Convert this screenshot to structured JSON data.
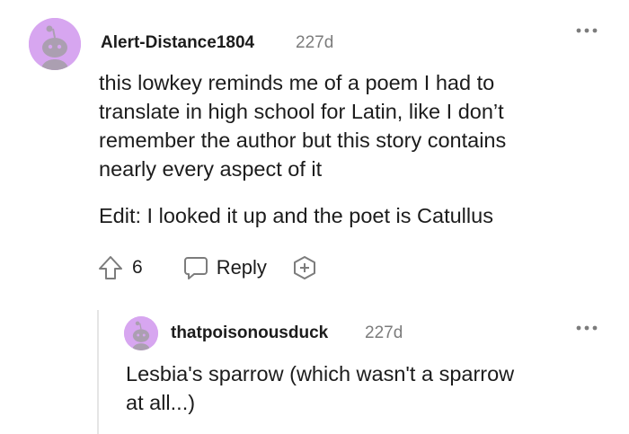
{
  "comment": {
    "username": "Alert-Distance1804",
    "age": "227d",
    "more_icon": "ellipsis-icon",
    "body_lines": [
      "this lowkey reminds me of a poem I had to",
      "translate in high school for Latin, like I don’t",
      "remember the author but this story contains",
      "nearly every aspect of it"
    ],
    "edit_line": "Edit: I looked it up and the poet is Catullus",
    "vote_count": "6",
    "reply_label": "Reply",
    "avatar_color": "#d7a6f0"
  },
  "reply": {
    "username": "thatpoisonousduck",
    "age": "227d",
    "more_icon": "ellipsis-icon",
    "body_lines": [
      "Lesbia's sparrow (which wasn't a sparrow",
      "at all...)"
    ],
    "avatar_color": "#d7a6f0"
  }
}
